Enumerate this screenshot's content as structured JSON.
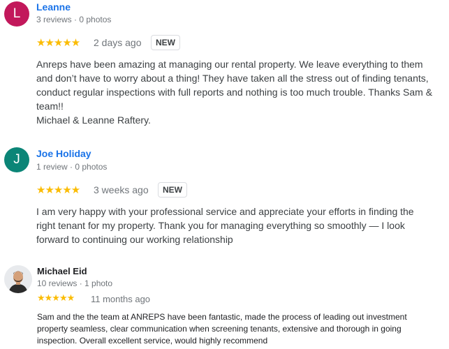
{
  "reviews": [
    {
      "initial": "L",
      "author": "Leanne",
      "meta": "3 reviews · 0 photos",
      "stars": "★★★★★",
      "date": "2 days ago",
      "badge": "NEW",
      "avatar_color": "#c2185b",
      "text": "Anreps have been amazing at managing our rental property. We leave everything to them\nand don’t have to worry about a thing! They have taken all the stress out of finding tenants,\nconduct regular inspections with full reports and nothing is too much trouble. Thanks Sam &\nteam!!\nMichael & Leanne Raftery."
    },
    {
      "initial": "J",
      "author": "Joe Holiday",
      "meta": "1 review · 0 photos",
      "stars": "★★★★★",
      "date": "3 weeks ago",
      "badge": "NEW",
      "avatar_color": "#0b8577",
      "text": "I am very happy with your professional service and appreciate your efforts in finding the\nright tenant for my property. Thank you for managing everything so smoothly — I look\nforward to continuing our working relationship"
    },
    {
      "author": "Michael Eid",
      "meta": "10 reviews · 1 photo",
      "stars": "★★★★★",
      "date": "11 months ago",
      "avatar_type": "photo",
      "text": "Sam and the the team at ANREPS have been fantastic, made the process of leading out investment\nproperty seamless,   clear communication when screening tenants, extensive and thorough in going\ninspection. Overall excellent service, would highly recommend"
    }
  ],
  "colors": {
    "star": "#fbbc04",
    "link": "#1a73e8",
    "meta": "#70757a"
  }
}
